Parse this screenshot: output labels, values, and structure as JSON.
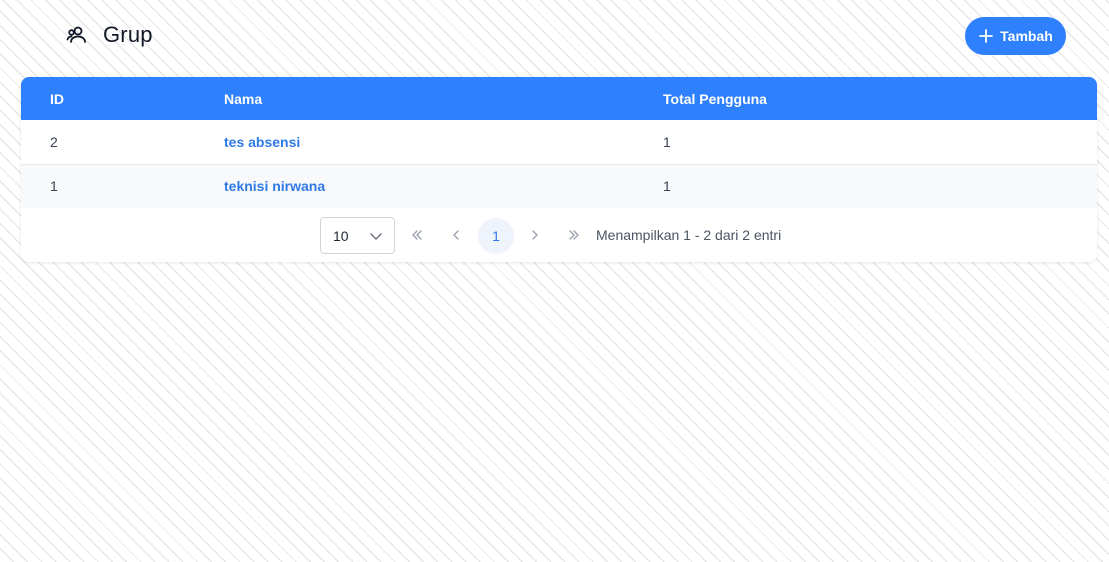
{
  "page": {
    "title": "Grup",
    "title_icon": "users-icon"
  },
  "toolbar": {
    "add_label": "Tambah",
    "add_icon": "plus-icon"
  },
  "table": {
    "headers": {
      "id": "ID",
      "nama": "Nama",
      "total": "Total Pengguna"
    },
    "rows": [
      {
        "id": "2",
        "nama": "tes absensi",
        "total": "1"
      },
      {
        "id": "1",
        "nama": "teknisi nirwana",
        "total": "1"
      }
    ]
  },
  "pagination": {
    "page_size": "10",
    "current_page": "1",
    "info": "Menampilkan 1 - 2 dari 2 entri"
  },
  "colors": {
    "accent": "#2f80fd",
    "link": "#2f7ae6"
  }
}
